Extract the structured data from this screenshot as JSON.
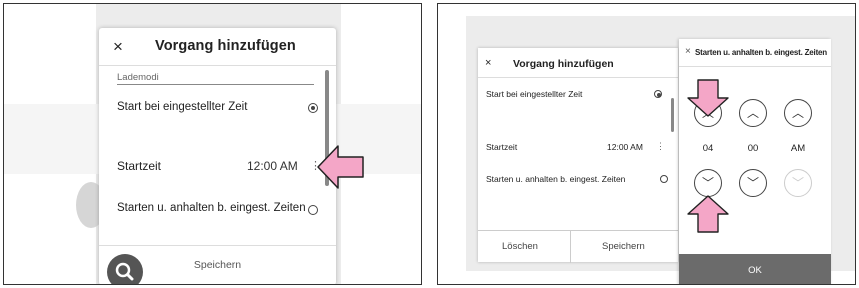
{
  "left_screen": {
    "dialog": {
      "close_glyph": "×",
      "title": "Vorgang hinzufügen",
      "section_label": "Lademodi",
      "option_scheduled_start": "Start bei eingestellter Zeit",
      "start_time_label": "Startzeit",
      "start_time_value": "12:00 AM",
      "option_start_stop": "Starten u. anhalten b. eingest. Zeiten",
      "save_label": "Speichern",
      "scheduled_start_selected": true,
      "start_stop_selected": false
    },
    "icons": [
      "close-icon",
      "kebab-menu-icon",
      "search-icon",
      "callout-arrow-icon"
    ],
    "colors": {
      "callout_arrow": "#f4a6c7",
      "fab": "#555555"
    }
  },
  "right_screen": {
    "dialog": {
      "close_glyph": "×",
      "title": "Vorgang hinzufügen",
      "option_scheduled_start": "Start bei eingestellter Zeit",
      "start_time_label": "Startzeit",
      "start_time_value": "12:00 AM",
      "option_start_stop": "Starten u. anhalten b. eingest. Zeiten",
      "delete_label": "Löschen",
      "save_label": "Speichern"
    },
    "time_picker": {
      "close_glyph": "×",
      "title": "Starten u. anhalten b. eingest. Zeiten",
      "hour": "04",
      "minute": "00",
      "period": "AM",
      "ok_label": "OK"
    },
    "icons": [
      "chevron-up-icon",
      "chevron-down-icon",
      "callout-arrow-icon"
    ],
    "colors": {
      "callout_arrow": "#f4a6c7",
      "ok_bar": "#6b6b6b"
    }
  }
}
